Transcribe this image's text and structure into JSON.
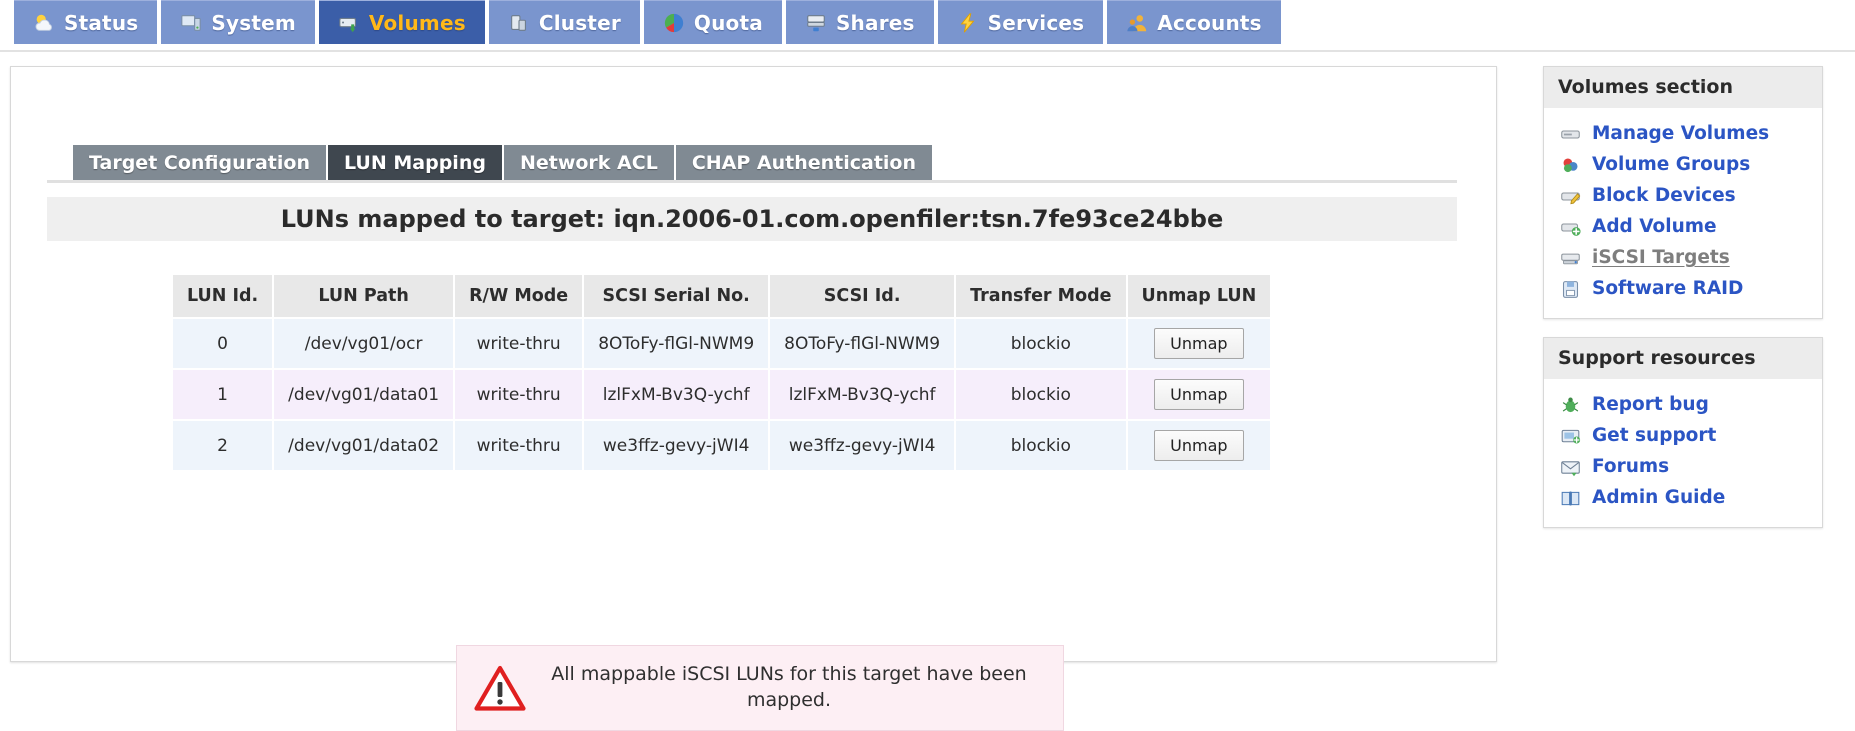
{
  "topnav": {
    "tabs": [
      {
        "label": "Status",
        "icon": "weather-status-icon",
        "active": false
      },
      {
        "label": "System",
        "icon": "monitor-system-icon",
        "active": false
      },
      {
        "label": "Volumes",
        "icon": "disk-volumes-icon",
        "active": true
      },
      {
        "label": "Cluster",
        "icon": "cluster-nodes-icon",
        "active": false
      },
      {
        "label": "Quota",
        "icon": "pie-quota-icon",
        "active": false
      },
      {
        "label": "Shares",
        "icon": "server-shares-icon",
        "active": false
      },
      {
        "label": "Services",
        "icon": "lightning-services-icon",
        "active": false
      },
      {
        "label": "Accounts",
        "icon": "users-accounts-icon",
        "active": false
      }
    ]
  },
  "subtabs": [
    {
      "label": "Target Configuration",
      "active": false
    },
    {
      "label": "LUN Mapping",
      "active": true
    },
    {
      "label": "Network ACL",
      "active": false
    },
    {
      "label": "CHAP Authentication",
      "active": false
    }
  ],
  "main": {
    "heading": "LUNs mapped to target: iqn.2006-01.com.openfiler:tsn.7fe93ce24bbe",
    "table": {
      "columns": [
        "LUN Id.",
        "LUN Path",
        "R/W Mode",
        "SCSI Serial No.",
        "SCSI Id.",
        "Transfer Mode",
        "Unmap LUN"
      ],
      "rows": [
        {
          "lun_id": "0",
          "lun_path": "/dev/vg01/ocr",
          "rw_mode": "write-thru",
          "scsi_serial": "8OToFy-flGl-NWM9",
          "scsi_id": "8OToFy-flGl-NWM9",
          "transfer_mode": "blockio",
          "action_label": "Unmap"
        },
        {
          "lun_id": "1",
          "lun_path": "/dev/vg01/data01",
          "rw_mode": "write-thru",
          "scsi_serial": "lzlFxM-Bv3Q-ychf",
          "scsi_id": "lzlFxM-Bv3Q-ychf",
          "transfer_mode": "blockio",
          "action_label": "Unmap"
        },
        {
          "lun_id": "2",
          "lun_path": "/dev/vg01/data02",
          "rw_mode": "write-thru",
          "scsi_serial": "we3ffz-gevy-jWI4",
          "scsi_id": "we3ffz-gevy-jWI4",
          "transfer_mode": "blockio",
          "action_label": "Unmap"
        }
      ]
    },
    "warning": {
      "icon": "warning-triangle-icon",
      "text": "All mappable iSCSI LUNs for this target have been mapped."
    }
  },
  "sidebar": {
    "panels": [
      {
        "title": "Volumes section",
        "links": [
          {
            "label": "Manage Volumes",
            "icon": "drive-icon",
            "current": false
          },
          {
            "label": "Volume Groups",
            "icon": "volume-group-icon",
            "current": false
          },
          {
            "label": "Block Devices",
            "icon": "block-device-icon",
            "current": false
          },
          {
            "label": "Add Volume",
            "icon": "add-volume-icon",
            "current": false
          },
          {
            "label": "iSCSI Targets",
            "icon": "iscsi-target-icon",
            "current": true
          },
          {
            "label": "Software RAID",
            "icon": "raid-icon",
            "current": false
          }
        ]
      },
      {
        "title": "Support resources",
        "links": [
          {
            "label": "Report bug",
            "icon": "bug-icon",
            "current": false
          },
          {
            "label": "Get support",
            "icon": "support-icon",
            "current": false
          },
          {
            "label": "Forums",
            "icon": "mail-forums-icon",
            "current": false
          },
          {
            "label": "Admin Guide",
            "icon": "book-icon",
            "current": false
          }
        ]
      }
    ]
  },
  "colors": {
    "nav_tab_bg": "#7a95ce",
    "nav_tab_active_bg": "#3b5ea8",
    "nav_tab_active_text": "#ffb819",
    "subtab_bg": "#808a93",
    "subtab_active_bg": "#3f474f",
    "link_blue": "#2b55c4",
    "row_even_bg": "#eef4fb",
    "row_odd_bg": "#f6eefb",
    "warning_bg": "#fdeff4",
    "warning_red": "#e02020"
  }
}
